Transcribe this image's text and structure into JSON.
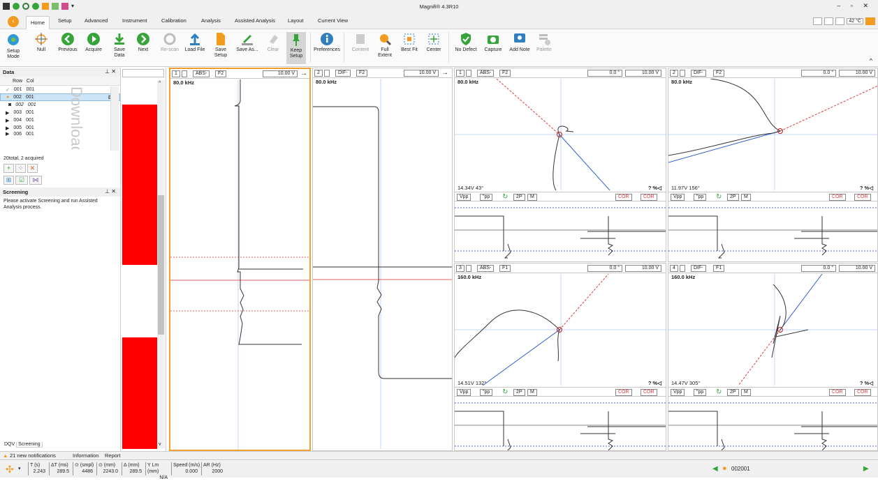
{
  "app": {
    "title": "Magnifi® 4.3R10",
    "temp": "42 °C"
  },
  "tabs": [
    "Home",
    "Setup",
    "Advanced",
    "Instrument",
    "Calibration",
    "Analysis",
    "Assisted Analysis",
    "Layout",
    "Current View"
  ],
  "ribbon": [
    "Setup Mode",
    "Null",
    "Previous",
    "Acquire",
    "Save Data",
    "Next",
    "Re-scan",
    "Load File",
    "Save Setup",
    "Save As...",
    "Clear",
    "Keep Setup",
    "Preferences",
    "Content",
    "Full Extent",
    "Best Fit",
    "Center",
    "No Defect",
    "Capture",
    "Add Note",
    "Palette"
  ],
  "data_panel": {
    "title": "Data",
    "col_row": "Row",
    "col_col": "Col",
    "rows": [
      {
        "r": "001",
        "c": "001"
      },
      {
        "r": "002",
        "c": "001"
      },
      {
        "r": "002",
        "c": "001"
      },
      {
        "r": "003",
        "c": "001"
      },
      {
        "r": "004",
        "c": "001"
      },
      {
        "r": "005",
        "c": "001"
      },
      {
        "r": "006",
        "c": "001"
      }
    ],
    "total": "20total, 2 acquired",
    "watermark": "Download"
  },
  "screening": {
    "title": "Screening",
    "message": "Please activate Screening and run Assisted Analysis process."
  },
  "bottom_tabs": {
    "dqv": "DQV",
    "screening": "Screening"
  },
  "strips": [
    {
      "ch": "1",
      "mode": "ABS-",
      "f": "F2",
      "volt": "10.00 V",
      "freq": "80.0 kHz"
    },
    {
      "ch": "2",
      "mode": "DIF-",
      "f": "F2",
      "volt": "10.00 V",
      "freq": "80.0 kHz"
    }
  ],
  "lissajous": [
    {
      "ch": "1",
      "mode": "ABS-",
      "f": "F2",
      "angle": "0.0 °",
      "volt": "10.00 V",
      "freq": "80.0 kHz",
      "reading": "14.34V 43°"
    },
    {
      "ch": "2",
      "mode": "DIF-",
      "f": "F2",
      "angle": "0.0 °",
      "volt": "10.00 V",
      "freq": "80.0 kHz",
      "reading": "11.97V 156°"
    },
    {
      "ch": "3",
      "mode": "ABS-",
      "f": "F1",
      "angle": "0.0 °",
      "volt": "10.00 V",
      "freq": "160.0 kHz",
      "reading": "14.51V 132°"
    },
    {
      "ch": "4",
      "mode": "DIF-",
      "f": "F1",
      "angle": "0.0 °",
      "volt": "10.00 V",
      "freq": "160.0 kHz",
      "reading": "14.47V 305°"
    }
  ],
  "ctl": {
    "vpp": "Vpp",
    "pp": "\"pp",
    "p2": "2P",
    "m": "M",
    "cor": "COR",
    "q": "? %◁"
  },
  "notif": {
    "text": "21 new notifications",
    "info": "Information",
    "report": "Report"
  },
  "status": [
    {
      "l": "T (s)",
      "v": "2.243"
    },
    {
      "l": "ΔT (ms)",
      "v": "289.5"
    },
    {
      "l": "⊙ (smpl)",
      "v": "4486"
    },
    {
      "l": "⊙ (mm)",
      "v": "2243.0"
    },
    {
      "l": "Δ (mm)",
      "v": "289.5"
    },
    {
      "l": "Y Lm (mm)",
      "v": "N/A"
    },
    {
      "l": "Speed (m/s)",
      "v": "0.000"
    },
    {
      "l": "AR (Hz)",
      "v": "2000"
    }
  ],
  "record": "002001"
}
